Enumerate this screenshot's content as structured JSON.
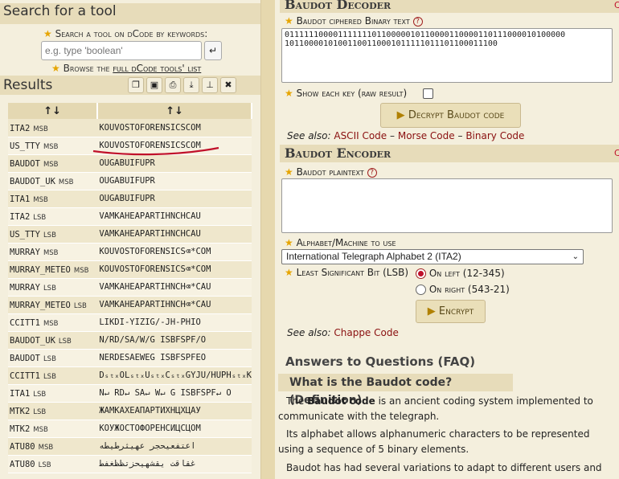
{
  "search": {
    "title": "Search for a tool",
    "prompt": "Search a tool on dCode by keywords:",
    "placeholder": "e.g. type 'boolean'",
    "go_icon": "enter-icon",
    "browse_prefix": "Browse the ",
    "browse_link": "full dCode tools' list"
  },
  "results": {
    "title": "Results",
    "toolbar_icons": [
      "copy-icon",
      "save-icon",
      "print-icon",
      "download-icon",
      "pin-icon",
      "close-icon"
    ],
    "headers": [
      "↑↓",
      "↑↓"
    ],
    "rows": [
      {
        "a": "ITA2",
        "m": "MSB",
        "v": "KOUVOSTOFORENSICSCOM"
      },
      {
        "a": "US_TTY",
        "m": "MSB",
        "v": "KOUVOSTOFORENSICSCOM"
      },
      {
        "a": "BAUDOT",
        "m": "MSB",
        "v": "OUGABUIFUPR"
      },
      {
        "a": "BAUDOT_UK",
        "m": "MSB",
        "v": "OUGABUIFUPR"
      },
      {
        "a": "ITA1",
        "m": "MSB",
        "v": "OUGABUIFUPR"
      },
      {
        "a": "ITA2",
        "m": "LSB",
        "v": "VAMKAHEAPARTIHNCHCAU"
      },
      {
        "a": "US_TTY",
        "m": "LSB",
        "v": "VAMKAHEAPARTIHNCHCAU"
      },
      {
        "a": "MURRAY",
        "m": "MSB",
        "v": "KOUVOSTOFORENSICS⌫*COM"
      },
      {
        "a": "MURRAY_METEO",
        "m": "MSB",
        "v": "KOUVOSTOFORENSICS⌫*COM"
      },
      {
        "a": "MURRAY",
        "m": "LSB",
        "v": "VAMKAHEAPARTIHNCH⌫*CAU"
      },
      {
        "a": "MURRAY_METEO",
        "m": "LSB",
        "v": "VAMKAHEAPARTIHNCH⌫*CAU"
      },
      {
        "a": "CCITT1",
        "m": "MSB",
        "v": "LIKDI-YIZIG/-JH-PHIO"
      },
      {
        "a": "BAUDOT_UK",
        "m": "LSB",
        "v": "N/RD/SA/W/G ISBFSPF/O"
      },
      {
        "a": "BAUDOT",
        "m": "LSB",
        "v": "NERDESAEWEG ISBFSPFEO"
      },
      {
        "a": "CCITT1",
        "m": "LSB",
        "v": "DₛₜₓOLₛₜₓUₛₜₓCₛₜₓGYJU/HUPHₛₜₓK"
      },
      {
        "a": "ITA1",
        "m": "LSB",
        "v": "N↵ RD↵ SA↵ W↵ G ISBFSPF↵ O"
      },
      {
        "a": "MTK2",
        "m": "LSB",
        "v": "ЖАМКАХЕАПАРТИХНЦХЦАУ"
      },
      {
        "a": "MTK2",
        "m": "MSB",
        "v": "КОУЖОСТОФОРЕНСИЦСЦОМ"
      },
      {
        "a": "ATU80",
        "m": "MSB",
        "v": "اعتفعيحجر عهيثرطيطه"
      },
      {
        "a": "ATU80",
        "m": "LSB",
        "v": "غقاقت يقشهيحزتظظغفط"
      }
    ]
  },
  "decoder": {
    "title": "Baudot Decoder",
    "field_label": "Baudot ciphered Binary text",
    "ciphertext": "0111111000011111110110000010110000110000110111000010100000\n10110000101001100110001011111011101100011100",
    "show_key_label": "Show each key (raw result)",
    "decrypt_label": "Decrypt Baudot code",
    "see_also": "See also:",
    "links": [
      "ASCII Code",
      "Morse Code",
      "Binary Code"
    ],
    "sep": "–"
  },
  "encoder": {
    "title": "Baudot Encoder",
    "plaintext_label": "Baudot plaintext",
    "plaintext_value": "",
    "alphabet_label": "Alphabet/Machine to use",
    "alphabet_selected": "International Telegraph Alphabet 2 (ITA2)",
    "lsb_label": "Least Significant Bit (LSB)",
    "on_left": "On left",
    "on_left_detail": "(12-345)",
    "on_right": "On right",
    "on_right_detail": "(543-21)",
    "encrypt_label": "Encrypt",
    "see_also": "See also:",
    "link": "Chappe Code"
  },
  "faq": {
    "title": "Answers to Questions (FAQ)",
    "q1": "What is the Baudot code? (Definition)",
    "p1_pre": "The ",
    "p1_bold": "Baudot code",
    "p1_post": " is an ancient coding system implemented to communicate with the telegraph.",
    "p2": "Its alphabet allows alphanumeric characters to be represented using a sequence of 5 binary elements.",
    "p3": "Baudot has had several variations to adapt to different users and"
  },
  "colors": {
    "accent": "#8a1010",
    "star": "#e6a500",
    "panel": "#f4efdd",
    "title_bg": "#e7dcba",
    "underline": "#c0102a"
  }
}
